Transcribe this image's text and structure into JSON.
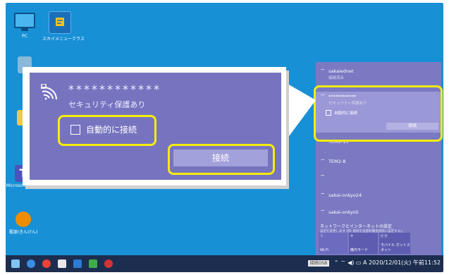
{
  "desktop": {
    "icons": [
      {
        "label": "PC"
      },
      {
        "label": "スカイメニュークラス"
      },
      {
        "label": "Microsoft Teams"
      },
      {
        "label": "電源(きんけん)"
      }
    ]
  },
  "callout": {
    "ssid": "************",
    "security": "セキュリティ保護あり",
    "auto_connect_label": "自動的に接続",
    "connect_label": "接続"
  },
  "flyout": {
    "networks": [
      {
        "name": "sakaiednet",
        "status": "接続済み"
      },
      {
        "name": "************",
        "status": "セキュリティ保護あり"
      },
      {
        "name": "TEM2-11",
        "status": ""
      },
      {
        "name": "TEM2-8",
        "status": ""
      },
      {
        "name": "",
        "status": ""
      },
      {
        "name": "sakai-onkyo24",
        "status": ""
      },
      {
        "name": "sakai-onkyo5",
        "status": ""
      }
    ],
    "auto_connect_label": "自動的に接続",
    "connect_label": "接続",
    "settings_title": "ネットワークとインターネットの設定",
    "settings_sub": "設定を変更します (例: 接続を従量制課金接続に設定する)。",
    "tiles": [
      {
        "label": "Wi-Fi"
      },
      {
        "label": "機内モード"
      },
      {
        "label": "モバイル ホットスポット"
      }
    ]
  },
  "taskbar": {
    "ime_badge": "接続OSB",
    "clock": "A 2020/12/01(火) 午前11:52"
  },
  "colors": {
    "desktop": "#1790d6",
    "flyout": "#7a79c2",
    "highlight": "#f6ec0a",
    "taskbar": "#1c2d4f"
  }
}
